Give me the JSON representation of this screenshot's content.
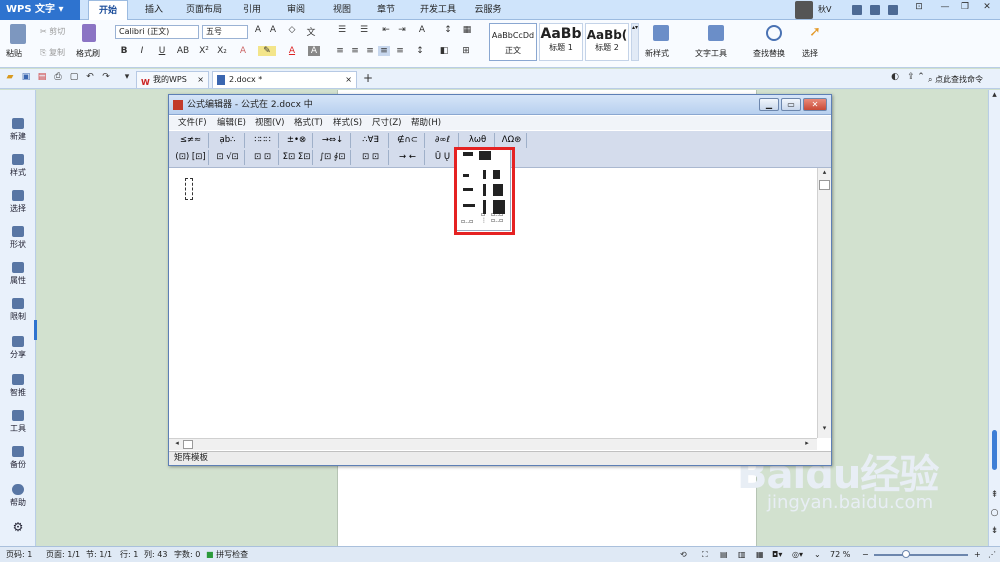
{
  "app": {
    "name": "WPS 文字",
    "user": "秋V"
  },
  "menu_tabs": [
    "开始",
    "插入",
    "页面布局",
    "引用",
    "审阅",
    "视图",
    "章节",
    "开发工具",
    "云服务"
  ],
  "active_tab": "开始",
  "ribbon": {
    "paste": "粘贴",
    "cut": "剪切",
    "copy": "复制",
    "format_painter": "格式刷",
    "font_name": "Calibri (正文)",
    "font_size": "五号",
    "style_normal_preview": "AaBbCcDd",
    "style_normal": "正文",
    "style_h1_preview": "AaBb",
    "style_h1": "标题 1",
    "style_h2_preview": "AaBb(",
    "style_h2": "标题 2",
    "new_style": "新样式",
    "text_tools": "文字工具",
    "find_replace": "查找替换",
    "select": "选择"
  },
  "doc_tabs": [
    "我的WPS",
    "2.docx *"
  ],
  "search_cmd": "点此查找命令",
  "left_panel": [
    "新建",
    "样式",
    "选择",
    "形状",
    "属性",
    "限制",
    "分享",
    "智推",
    "工具",
    "备份",
    "帮助"
  ],
  "equation_editor": {
    "title": "公式编辑器 - 公式在 2.docx 中",
    "menu": [
      "文件(F)",
      "编辑(E)",
      "视图(V)",
      "格式(T)",
      "样式(S)",
      "尺寸(Z)",
      "帮助(H)"
    ],
    "toolbar_row1": [
      "≤≠≈",
      "ạb∴",
      "∷∷∷",
      "±•⊗",
      "→⇔↓",
      "∴∀∃",
      "∉∩⊂",
      "∂∞ℓ",
      "λωθ",
      "ΛΩ⊛"
    ],
    "toolbar_row2": [
      "(⊡) [⊡]",
      "⊡ √⊡",
      "⊡ ⊡",
      "Σ⊡ Σ⊡",
      "∫⊡ ∮⊡",
      "⊡ ⊡",
      "→ ←",
      "Ū Ų"
    ],
    "status": "矩阵模板"
  },
  "status_bar": {
    "page_num": "页码: 1",
    "pages": "页面: 1/1",
    "section": "节: 1/1",
    "row": "行: 1",
    "col": "列: 43",
    "word_count": "字数: 0",
    "spell_check": "拼写检查",
    "zoom": "72 %"
  },
  "watermark": {
    "logo": "Baidu经验",
    "url": "jingyan.baidu.com"
  },
  "colors": {
    "accent": "#2e73cf",
    "highlight": "#e52222",
    "doc_bg": "#d2e1cf"
  }
}
